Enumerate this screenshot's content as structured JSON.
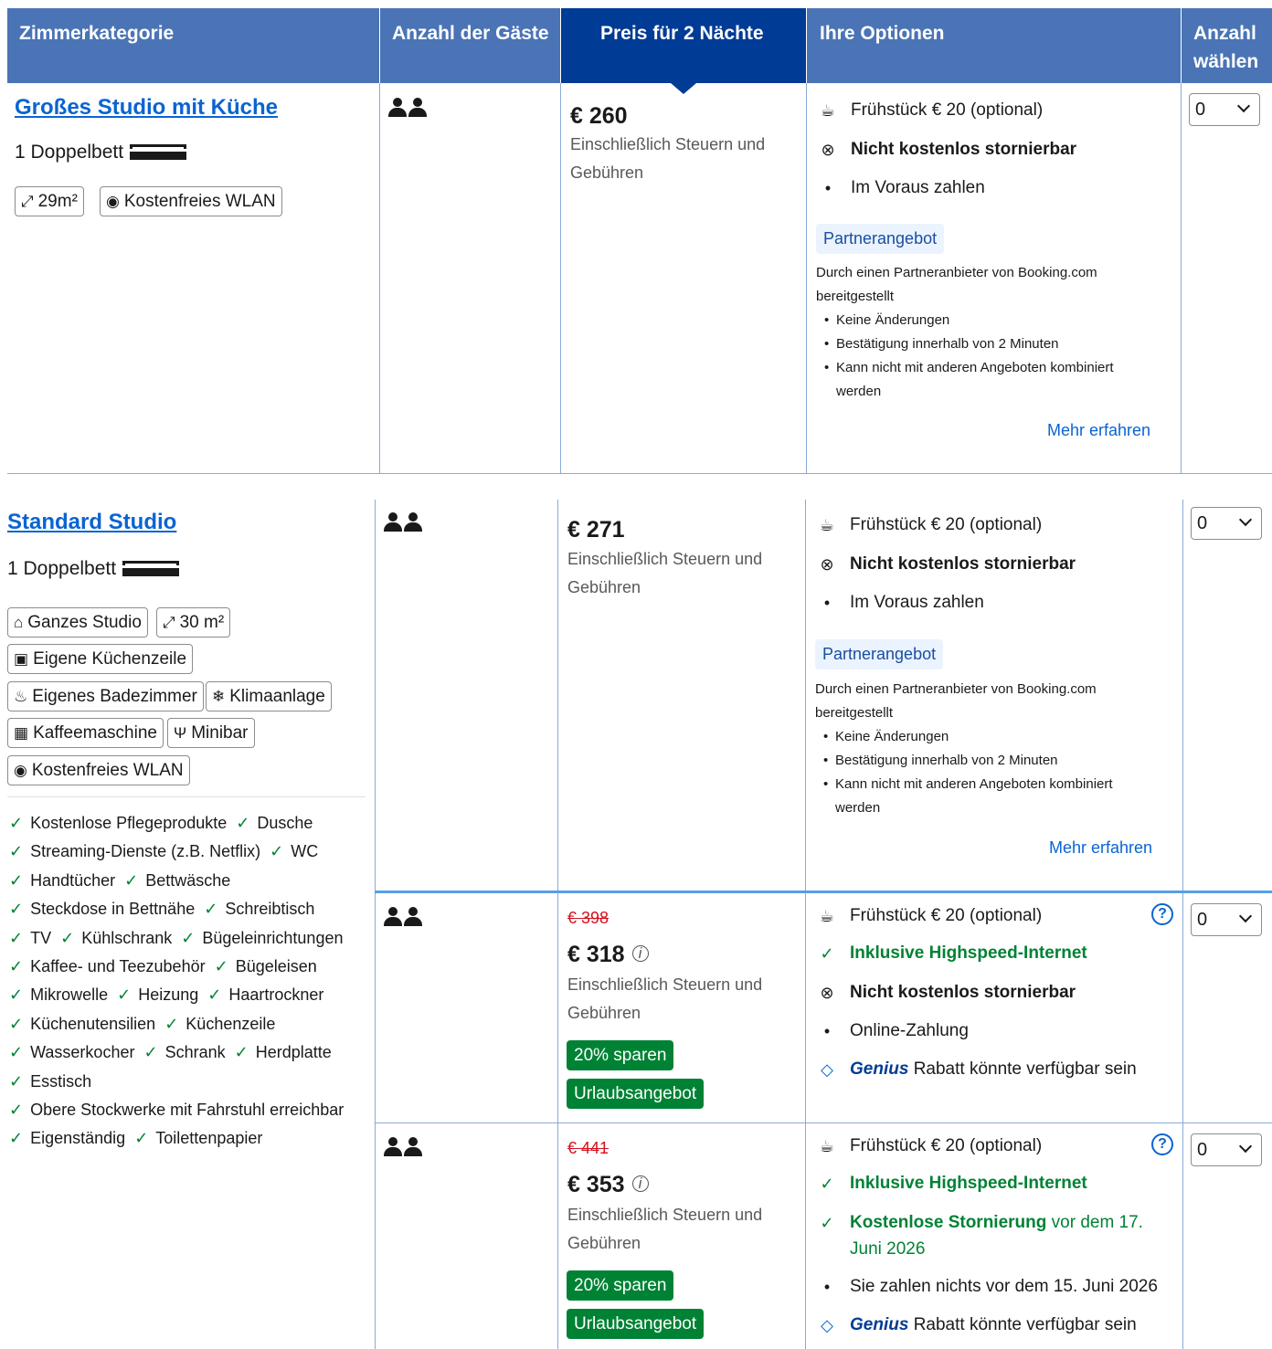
{
  "header": {
    "col_room": "Zimmerkategorie",
    "col_guests": "Anzahl der Gäste",
    "col_price": "Preis für 2 Nächte",
    "col_options": "Ihre Optionen",
    "col_select_1": "Anzahl",
    "col_select_2": "wählen"
  },
  "room1": {
    "title": "Großes Studio mit Küche",
    "bed": "1 Doppelbett",
    "chips": [
      "29m²",
      "Kostenfreies WLAN"
    ],
    "price": "€ 260",
    "price_note": "Einschließlich Steuern und Gebühren",
    "breakfast": "Frühstück € 20 (optional)",
    "cancel": "Nicht kostenlos stornierbar",
    "payment": "Im Voraus zahlen",
    "partner_badge": "Partnerangebot",
    "partner_text": "Durch einen Partneranbieter von Booking.com bereitgestellt",
    "partner_bullets": [
      "Keine Änderungen",
      "Bestätigung innerhalb von 2 Minuten",
      "Kann nicht mit anderen Angeboten kombiniert werden"
    ],
    "more": "Mehr erfahren",
    "qty": "0"
  },
  "room2": {
    "title": "Standard Studio",
    "bed": "1 Doppelbett",
    "chips": [
      "Ganzes Studio",
      "30 m²",
      "Eigene Küchenzeile",
      "Eigenes Badezimmer",
      "Klimaanlage",
      "Kaffeemaschine",
      "Minibar",
      "Kostenfreies WLAN"
    ],
    "facilities": [
      [
        "Kostenlose Pflegeprodukte",
        "Dusche"
      ],
      [
        "Streaming-Dienste (z.B. Netflix)",
        "WC"
      ],
      [
        "Handtücher",
        "Bettwäsche"
      ],
      [
        "Steckdose in Bettnähe",
        "Schreibtisch"
      ],
      [
        "TV",
        "Kühlschrank",
        "Bügeleinrichtungen"
      ],
      [
        "Kaffee- und Teezubehör",
        "Bügeleisen"
      ],
      [
        "Mikrowelle",
        "Heizung",
        "Haartrockner"
      ],
      [
        "Küchenutensilien",
        "Küchenzeile"
      ],
      [
        "Wasserkocher",
        "Schrank",
        "Herdplatte"
      ],
      [
        "Esstisch"
      ],
      [
        "Obere Stockwerke mit Fahrstuhl erreichbar"
      ],
      [
        "Eigenständig",
        "Toilettenpapier"
      ]
    ],
    "offers": [
      {
        "price": "€ 271",
        "price_note": "Einschließlich Steuern und Gebühren",
        "breakfast": "Frühstück € 20 (optional)",
        "cancel": "Nicht kostenlos stornierbar",
        "payment": "Im Voraus zahlen",
        "partner_badge": "Partnerangebot",
        "partner_text": "Durch einen Partneranbieter von Booking.com bereitgestellt",
        "partner_bullets": [
          "Keine Änderungen",
          "Bestätigung innerhalb von 2 Minuten",
          "Kann nicht mit anderen Angeboten kombiniert werden"
        ],
        "more": "Mehr erfahren",
        "qty": "0"
      },
      {
        "old_price": "€ 398",
        "price": "€ 318",
        "price_note": "Einschließlich Steuern und Gebühren",
        "badge_save": "20% sparen",
        "badge_deal": "Urlaubsangebot",
        "breakfast": "Frühstück € 20 (optional)",
        "internet": "Inklusive Highspeed-Internet",
        "cancel": "Nicht kostenlos stornierbar",
        "payment": "Online-Zahlung",
        "genius": "Genius",
        "genius_text": "Rabatt könnte verfügbar sein",
        "qty": "0"
      },
      {
        "old_price": "€ 441",
        "price": "€ 353",
        "price_note": "Einschließlich Steuern und Gebühren",
        "badge_save": "20% sparen",
        "badge_deal": "Urlaubsangebot",
        "breakfast": "Frühstück € 20 (optional)",
        "internet": "Inklusive Highspeed-Internet",
        "cancel_free": "Kostenlose Stornierung",
        "cancel_free_rest": "vor dem 17.",
        "cancel_free_date2": "Juni 2026",
        "payment": "Sie zahlen nichts vor dem 15. Juni 2026",
        "genius": "Genius",
        "genius_text": "Rabatt könnte verfügbar sein",
        "qty": "0"
      }
    ]
  },
  "colors": {
    "header": "#4a74b5",
    "header_selected": "#003b95",
    "link": "#0a64d2",
    "green": "#008234",
    "red": "#d4111e"
  },
  "icons": [
    "bed-icon",
    "people-icon",
    "area-icon",
    "wifi-icon",
    "house-icon",
    "kitchen-icon",
    "bath-icon",
    "snowflake-icon",
    "coffee-icon",
    "minibar-icon",
    "coffee-cup-icon",
    "cancel-icon",
    "check-icon",
    "tag-icon",
    "help-icon",
    "chevron-down-icon"
  ]
}
